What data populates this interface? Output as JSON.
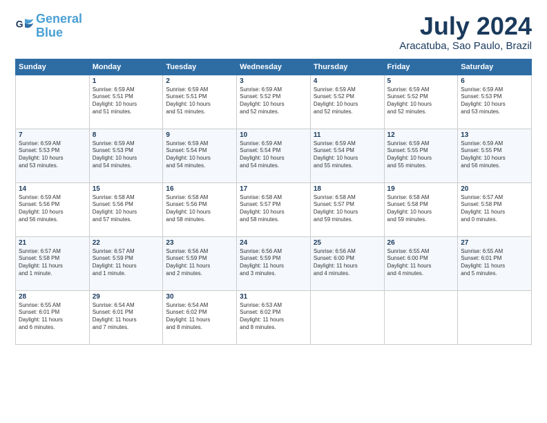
{
  "header": {
    "logo_line1": "General",
    "logo_line2": "Blue",
    "month": "July 2024",
    "location": "Aracatuba, Sao Paulo, Brazil"
  },
  "weekdays": [
    "Sunday",
    "Monday",
    "Tuesday",
    "Wednesday",
    "Thursday",
    "Friday",
    "Saturday"
  ],
  "weeks": [
    [
      {
        "day": "",
        "info": ""
      },
      {
        "day": "1",
        "info": "Sunrise: 6:59 AM\nSunset: 5:51 PM\nDaylight: 10 hours\nand 51 minutes."
      },
      {
        "day": "2",
        "info": "Sunrise: 6:59 AM\nSunset: 5:51 PM\nDaylight: 10 hours\nand 51 minutes."
      },
      {
        "day": "3",
        "info": "Sunrise: 6:59 AM\nSunset: 5:52 PM\nDaylight: 10 hours\nand 52 minutes."
      },
      {
        "day": "4",
        "info": "Sunrise: 6:59 AM\nSunset: 5:52 PM\nDaylight: 10 hours\nand 52 minutes."
      },
      {
        "day": "5",
        "info": "Sunrise: 6:59 AM\nSunset: 5:52 PM\nDaylight: 10 hours\nand 52 minutes."
      },
      {
        "day": "6",
        "info": "Sunrise: 6:59 AM\nSunset: 5:53 PM\nDaylight: 10 hours\nand 53 minutes."
      }
    ],
    [
      {
        "day": "7",
        "info": "Sunrise: 6:59 AM\nSunset: 5:53 PM\nDaylight: 10 hours\nand 53 minutes."
      },
      {
        "day": "8",
        "info": "Sunrise: 6:59 AM\nSunset: 5:53 PM\nDaylight: 10 hours\nand 54 minutes."
      },
      {
        "day": "9",
        "info": "Sunrise: 6:59 AM\nSunset: 5:54 PM\nDaylight: 10 hours\nand 54 minutes."
      },
      {
        "day": "10",
        "info": "Sunrise: 6:59 AM\nSunset: 5:54 PM\nDaylight: 10 hours\nand 54 minutes."
      },
      {
        "day": "11",
        "info": "Sunrise: 6:59 AM\nSunset: 5:54 PM\nDaylight: 10 hours\nand 55 minutes."
      },
      {
        "day": "12",
        "info": "Sunrise: 6:59 AM\nSunset: 5:55 PM\nDaylight: 10 hours\nand 55 minutes."
      },
      {
        "day": "13",
        "info": "Sunrise: 6:59 AM\nSunset: 5:55 PM\nDaylight: 10 hours\nand 56 minutes."
      }
    ],
    [
      {
        "day": "14",
        "info": "Sunrise: 6:59 AM\nSunset: 5:56 PM\nDaylight: 10 hours\nand 56 minutes."
      },
      {
        "day": "15",
        "info": "Sunrise: 6:58 AM\nSunset: 5:56 PM\nDaylight: 10 hours\nand 57 minutes."
      },
      {
        "day": "16",
        "info": "Sunrise: 6:58 AM\nSunset: 5:56 PM\nDaylight: 10 hours\nand 58 minutes."
      },
      {
        "day": "17",
        "info": "Sunrise: 6:58 AM\nSunset: 5:57 PM\nDaylight: 10 hours\nand 58 minutes."
      },
      {
        "day": "18",
        "info": "Sunrise: 6:58 AM\nSunset: 5:57 PM\nDaylight: 10 hours\nand 59 minutes."
      },
      {
        "day": "19",
        "info": "Sunrise: 6:58 AM\nSunset: 5:58 PM\nDaylight: 10 hours\nand 59 minutes."
      },
      {
        "day": "20",
        "info": "Sunrise: 6:57 AM\nSunset: 5:58 PM\nDaylight: 11 hours\nand 0 minutes."
      }
    ],
    [
      {
        "day": "21",
        "info": "Sunrise: 6:57 AM\nSunset: 5:58 PM\nDaylight: 11 hours\nand 1 minute."
      },
      {
        "day": "22",
        "info": "Sunrise: 6:57 AM\nSunset: 5:59 PM\nDaylight: 11 hours\nand 1 minute."
      },
      {
        "day": "23",
        "info": "Sunrise: 6:56 AM\nSunset: 5:59 PM\nDaylight: 11 hours\nand 2 minutes."
      },
      {
        "day": "24",
        "info": "Sunrise: 6:56 AM\nSunset: 5:59 PM\nDaylight: 11 hours\nand 3 minutes."
      },
      {
        "day": "25",
        "info": "Sunrise: 6:56 AM\nSunset: 6:00 PM\nDaylight: 11 hours\nand 4 minutes."
      },
      {
        "day": "26",
        "info": "Sunrise: 6:55 AM\nSunset: 6:00 PM\nDaylight: 11 hours\nand 4 minutes."
      },
      {
        "day": "27",
        "info": "Sunrise: 6:55 AM\nSunset: 6:01 PM\nDaylight: 11 hours\nand 5 minutes."
      }
    ],
    [
      {
        "day": "28",
        "info": "Sunrise: 6:55 AM\nSunset: 6:01 PM\nDaylight: 11 hours\nand 6 minutes."
      },
      {
        "day": "29",
        "info": "Sunrise: 6:54 AM\nSunset: 6:01 PM\nDaylight: 11 hours\nand 7 minutes."
      },
      {
        "day": "30",
        "info": "Sunrise: 6:54 AM\nSunset: 6:02 PM\nDaylight: 11 hours\nand 8 minutes."
      },
      {
        "day": "31",
        "info": "Sunrise: 6:53 AM\nSunset: 6:02 PM\nDaylight: 11 hours\nand 8 minutes."
      },
      {
        "day": "",
        "info": ""
      },
      {
        "day": "",
        "info": ""
      },
      {
        "day": "",
        "info": ""
      }
    ]
  ]
}
